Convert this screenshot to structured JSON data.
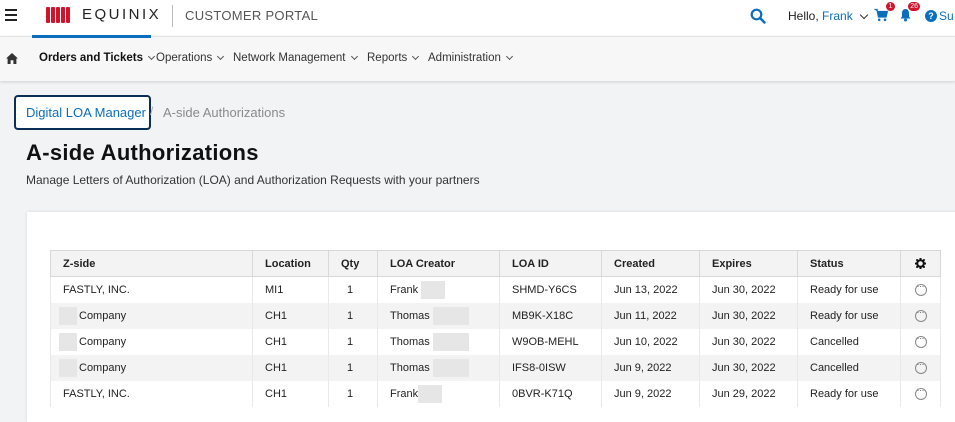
{
  "header": {
    "logo_text": "EQUINIX",
    "portal_title": "CUSTOMER PORTAL",
    "greeting": "Hello,",
    "user_name": "Frank",
    "cart_badge": "1",
    "notifications_badge": "26",
    "support_label": "Su"
  },
  "nav": {
    "items": [
      {
        "label": "Orders and Tickets"
      },
      {
        "label": "Operations"
      },
      {
        "label": "Network Management"
      },
      {
        "label": "Reports"
      },
      {
        "label": "Administration"
      }
    ]
  },
  "breadcrumb": {
    "root": "Digital LOA Manager",
    "separator": "/",
    "current": "A-side Authorizations"
  },
  "page": {
    "title": "A-side Authorizations",
    "subtitle": "Manage Letters of Authorization (LOA) and Authorization Requests with your partners"
  },
  "table": {
    "columns": [
      "Z-side",
      "Location",
      "Qty",
      "LOA Creator",
      "LOA ID",
      "Created",
      "Expires",
      "Status"
    ],
    "rows": [
      {
        "zside": "FASTLY, INC.",
        "location": "MI1",
        "qty": "1",
        "creator": "Frank",
        "loa_id": "SHMD-Y6CS",
        "created": "Jun 13, 2022",
        "expires": "Jun 30, 2022",
        "status": "Ready for use"
      },
      {
        "zside": "Company",
        "location": "CH1",
        "qty": "1",
        "creator": "Thomas",
        "loa_id": "MB9K-X18C",
        "created": "Jun 11, 2022",
        "expires": "Jun 30, 2022",
        "status": "Ready for use"
      },
      {
        "zside": "Company",
        "location": "CH1",
        "qty": "1",
        "creator": "Thomas",
        "loa_id": "W9OB-MEHL",
        "created": "Jun 10, 2022",
        "expires": "Jun 30, 2022",
        "status": "Cancelled"
      },
      {
        "zside": "Company",
        "location": "CH1",
        "qty": "1",
        "creator": "Thomas",
        "loa_id": "IFS8-0ISW",
        "created": "Jun 9, 2022",
        "expires": "Jun 30, 2022",
        "status": "Cancelled"
      },
      {
        "zside": "FASTLY, INC.",
        "location": "CH1",
        "qty": "1",
        "creator": "Frank",
        "loa_id": "0BVR-K71Q",
        "created": "Jun 9, 2022",
        "expires": "Jun 29, 2022",
        "status": "Ready for use"
      }
    ]
  },
  "colors": {
    "brand_red": "#d3132c",
    "link_blue": "#0a6ebd",
    "focus_border": "#0b2e57"
  }
}
